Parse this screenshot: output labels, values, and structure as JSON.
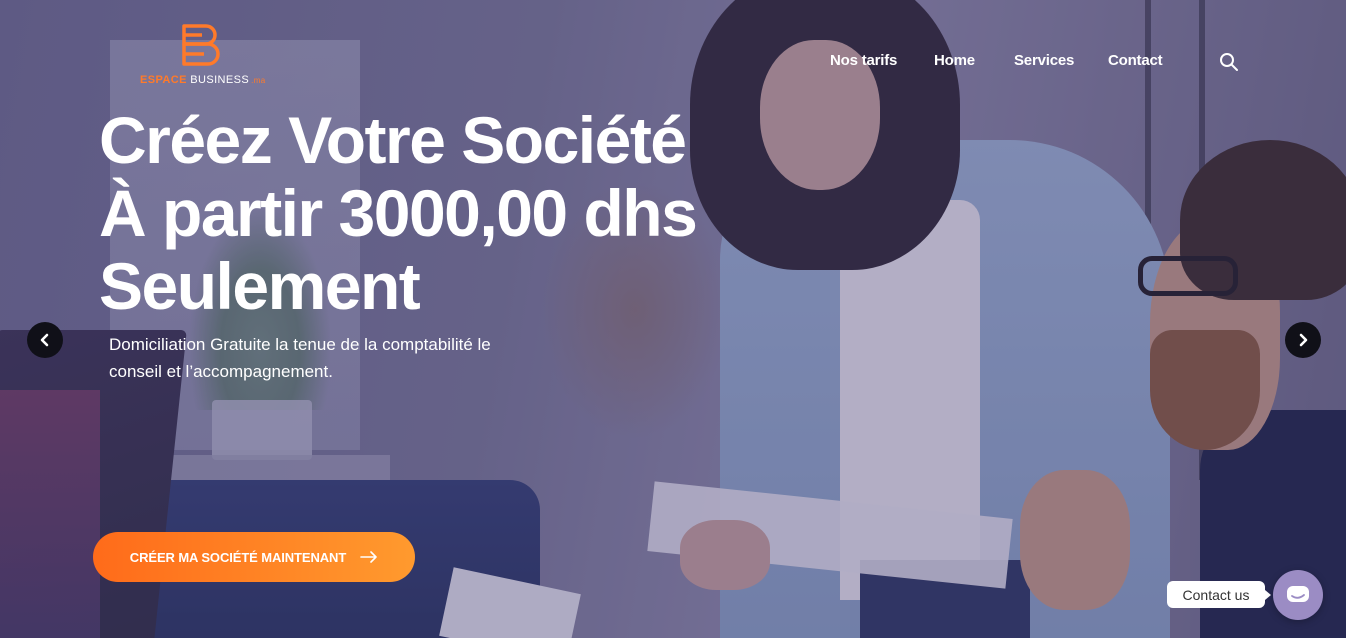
{
  "brand": {
    "logo_letter": "B",
    "name_part1": "ESPACE",
    "name_part2": " BUSINESS",
    "name_suffix": ".ma",
    "accent_color": "#ff7a2a"
  },
  "nav": {
    "items": [
      {
        "label": "Nos tarifs"
      },
      {
        "label": "Home"
      },
      {
        "label": "Services"
      },
      {
        "label": "Contact"
      }
    ],
    "search_icon": "search-icon"
  },
  "hero": {
    "headline_lines": [
      "Créez Votre Société",
      "À partir 3000,00 dhs",
      "Seulement"
    ],
    "subtitle": "Domiciliation Gratuite la tenue de la comptabilité le conseil et l’accompagnement.",
    "cta_label": "CRÉER MA SOCIÉTÉ MAINTENANT",
    "cta_icon": "arrow-right-icon",
    "cta_color_start": "#ff6b1a",
    "cta_color_end": "#ff9a2e",
    "prev_icon": "chevron-left-icon",
    "next_icon": "chevron-right-icon"
  },
  "contact_widget": {
    "label": "Contact us",
    "icon": "chat-icon",
    "color": "#9b8cc4"
  }
}
